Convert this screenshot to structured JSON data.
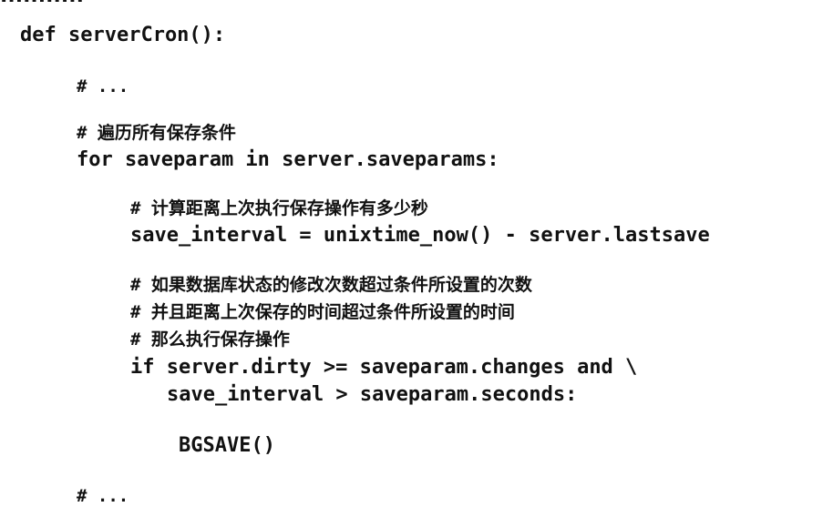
{
  "heading_partial": "...........",
  "code_lines": [
    "def serverCron():",
    "# ...",
    "# 遍历所有保存条件",
    "for saveparam in server.saveparams:",
    "# 计算距离上次执行保存操作有多少秒",
    "save_interval = unixtime_now() - server.lastsave",
    "# 如果数据库状态的修改次数超过条件所设置的次数",
    "# 并且距离上次保存的时间超过条件所设置的时间",
    "# 那么执行保存操作",
    "if server.dirty >= saveparam.changes and \\",
    "save_interval > saveparam.seconds:",
    "BGSAVE()",
    "# ..."
  ]
}
